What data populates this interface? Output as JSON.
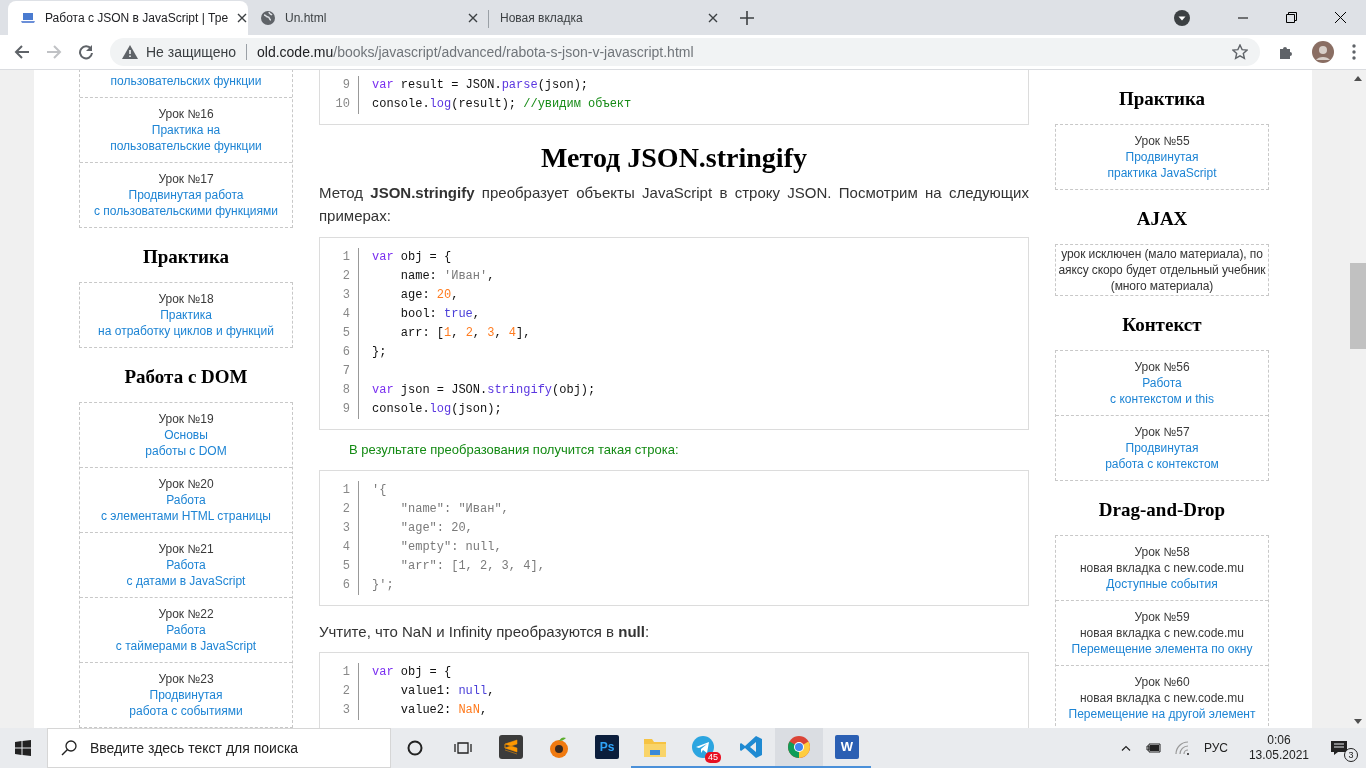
{
  "browser": {
    "tabs": [
      {
        "kind": "page",
        "title": "Работа с JSON в JavaScript | Тре",
        "selected": true
      },
      {
        "kind": "file",
        "title": "Un.html",
        "selected": false
      },
      {
        "kind": "blank",
        "title": "Новая вкладка",
        "selected": false
      }
    ],
    "security": "Не защищено",
    "url_host": "old.code.mu",
    "url_path": "/books/javascript/advanced/rabota-s-json-v-javascript.html"
  },
  "left_sidebar": [
    {
      "lessons": [
        {
          "title": "пользовательских функции"
        },
        {
          "number": "Урок №16",
          "title": "Практика на\nпользовательские функции"
        },
        {
          "number": "Урок №17",
          "title": "Продвинутая работа\nс пользовательскими функциями"
        }
      ]
    },
    {
      "heading": "Практика",
      "lessons": [
        {
          "number": "Урок №18",
          "title": "Практика\nна отработку циклов и функций"
        }
      ]
    },
    {
      "heading": "Работа с DOM",
      "lessons": [
        {
          "number": "Урок №19",
          "title": "Основы\nработы с DOM"
        },
        {
          "number": "Урок №20",
          "title": "Работа\nс элементами HTML страницы"
        },
        {
          "number": "Урок №21",
          "title": "Работа\nс датами в JavaScript"
        },
        {
          "number": "Урок №22",
          "title": "Работа\nс таймерами в JavaScript"
        },
        {
          "number": "Урок №23",
          "title": "Продвинутая\nработа с событиями"
        }
      ]
    }
  ],
  "article": [
    {
      "kind": "code",
      "lines": [
        {
          "n": "9",
          "tokens": [
            {
              "text": "var",
              "kind": "keyword"
            },
            {
              "text": " result = JSON.",
              "kind": "plain"
            },
            {
              "text": "parse",
              "kind": "method"
            },
            {
              "text": "(json);",
              "kind": "plain"
            }
          ]
        },
        {
          "n": "10",
          "tokens": [
            {
              "text": "console.",
              "kind": "plain"
            },
            {
              "text": "log",
              "kind": "method"
            },
            {
              "text": "(result); ",
              "kind": "plain"
            },
            {
              "text": "//увидим объект",
              "kind": "comment"
            }
          ]
        }
      ]
    },
    {
      "kind": "heading",
      "text": "Метод JSON.stringify"
    },
    {
      "kind": "paragraph",
      "text": "Метод **JSON.stringify** преобразует объекты JavaScript в строку JSON. Посмотрим на следующих примерах:"
    },
    {
      "kind": "code",
      "lines": [
        {
          "n": "1",
          "tokens": [
            {
              "text": "var",
              "kind": "keyword"
            },
            {
              "text": " obj = {",
              "kind": "plain"
            }
          ]
        },
        {
          "n": "2",
          "tokens": [
            {
              "text": "    name: ",
              "kind": "plain"
            },
            {
              "text": "'Иван'",
              "kind": "string"
            },
            {
              "text": ",",
              "kind": "plain"
            }
          ]
        },
        {
          "n": "3",
          "tokens": [
            {
              "text": "    age: ",
              "kind": "plain"
            },
            {
              "text": "20",
              "kind": "number"
            },
            {
              "text": ",",
              "kind": "plain"
            }
          ]
        },
        {
          "n": "4",
          "tokens": [
            {
              "text": "    bool: ",
              "kind": "plain"
            },
            {
              "text": "true",
              "kind": "literal"
            },
            {
              "text": ",",
              "kind": "plain"
            }
          ]
        },
        {
          "n": "5",
          "tokens": [
            {
              "text": "    arr: [",
              "kind": "plain"
            },
            {
              "text": "1",
              "kind": "number"
            },
            {
              "text": ", ",
              "kind": "plain"
            },
            {
              "text": "2",
              "kind": "number"
            },
            {
              "text": ", ",
              "kind": "plain"
            },
            {
              "text": "3",
              "kind": "number"
            },
            {
              "text": ", ",
              "kind": "plain"
            },
            {
              "text": "4",
              "kind": "number"
            },
            {
              "text": "],",
              "kind": "plain"
            }
          ]
        },
        {
          "n": "6",
          "tokens": [
            {
              "text": "};",
              "kind": "plain"
            }
          ]
        },
        {
          "n": "7"
        },
        {
          "n": "8",
          "tokens": [
            {
              "text": "var",
              "kind": "keyword"
            },
            {
              "text": " json = JSON.",
              "kind": "plain"
            },
            {
              "text": "stringify",
              "kind": "method"
            },
            {
              "text": "(obj);",
              "kind": "plain"
            }
          ]
        },
        {
          "n": "9",
          "tokens": [
            {
              "text": "console.",
              "kind": "plain"
            },
            {
              "text": "log",
              "kind": "method"
            },
            {
              "text": "(json);",
              "kind": "plain"
            }
          ]
        }
      ]
    },
    {
      "kind": "note",
      "text": "В результате преобразования получится такая строка:"
    },
    {
      "kind": "code",
      "lines": [
        {
          "n": "1",
          "tokens": [
            {
              "text": "'{",
              "kind": "string"
            }
          ]
        },
        {
          "n": "2",
          "tokens": [
            {
              "text": "    \"name\": \"Иван\",",
              "kind": "string"
            }
          ]
        },
        {
          "n": "3",
          "tokens": [
            {
              "text": "    \"age\": 20,",
              "kind": "string"
            }
          ]
        },
        {
          "n": "4",
          "tokens": [
            {
              "text": "    \"empty\": null,",
              "kind": "string"
            }
          ]
        },
        {
          "n": "5",
          "tokens": [
            {
              "text": "    \"arr\": [1, 2, 3, 4],",
              "kind": "string"
            }
          ]
        },
        {
          "n": "6",
          "tokens": [
            {
              "text": "}';",
              "kind": "string"
            }
          ]
        }
      ]
    },
    {
      "kind": "paragraph",
      "text": "Учтите, что NaN и Infinity преобразуются в **null**:"
    },
    {
      "kind": "code",
      "lines": [
        {
          "n": "1",
          "tokens": [
            {
              "text": "var",
              "kind": "keyword"
            },
            {
              "text": " obj = {",
              "kind": "plain"
            }
          ]
        },
        {
          "n": "2",
          "tokens": [
            {
              "text": "    value1: ",
              "kind": "plain"
            },
            {
              "text": "null",
              "kind": "literal"
            },
            {
              "text": ",",
              "kind": "plain"
            }
          ]
        },
        {
          "n": "3",
          "tokens": [
            {
              "text": "    value2: ",
              "kind": "plain"
            },
            {
              "text": "NaN",
              "kind": "number"
            },
            {
              "text": ",",
              "kind": "plain"
            }
          ]
        }
      ]
    }
  ],
  "right_sidebar": [
    {
      "heading": "Практика",
      "lessons": [
        {
          "number": "Урок №55",
          "title": "Продвинутая\nпрактика JavaScript"
        }
      ]
    },
    {
      "heading": "AJAX",
      "text": "урок исключен (мало материала), по\nаяксу скоро будет отдельный учебник\n(много материала)"
    },
    {
      "heading": "Контекст",
      "lessons": [
        {
          "number": "Урок №56",
          "title": "Работа\nс контекстом и this"
        },
        {
          "number": "Урок №57",
          "title": "Продвинутая\nработа с контекстом"
        }
      ]
    },
    {
      "heading": "Drag-and-Drop",
      "lessons": [
        {
          "number": "Урок №58",
          "note": "новая вкладка с new.code.mu",
          "title": "Доступные события"
        },
        {
          "number": "Урок №59",
          "note": "новая вкладка с new.code.mu",
          "title": "Перемещение элемента по окну"
        },
        {
          "number": "Урок №60",
          "note": "новая вкладка с new.code.mu",
          "title": "Перемещение на другой элемент"
        }
      ]
    }
  ],
  "taskbar": {
    "search_placeholder": "Введите здесь текст для поиска",
    "apps": [
      {
        "kind": "stripes",
        "running": false,
        "selected": false
      },
      {
        "kind": "fruit",
        "running": false,
        "selected": false
      },
      {
        "kind": "square",
        "label": "Ps",
        "running": false,
        "selected": false
      },
      {
        "kind": "folder",
        "running": true,
        "selected": false
      },
      {
        "kind": "plane",
        "running": true,
        "selected": false,
        "badge": "45"
      },
      {
        "kind": "ribbon",
        "running": true,
        "selected": false
      },
      {
        "kind": "ring",
        "running": true,
        "selected": true
      },
      {
        "kind": "doc",
        "label": "W",
        "running": true,
        "selected": false
      }
    ],
    "language": "РУС",
    "time": "0:06",
    "date": "13.05.2021",
    "notifications": "3"
  }
}
